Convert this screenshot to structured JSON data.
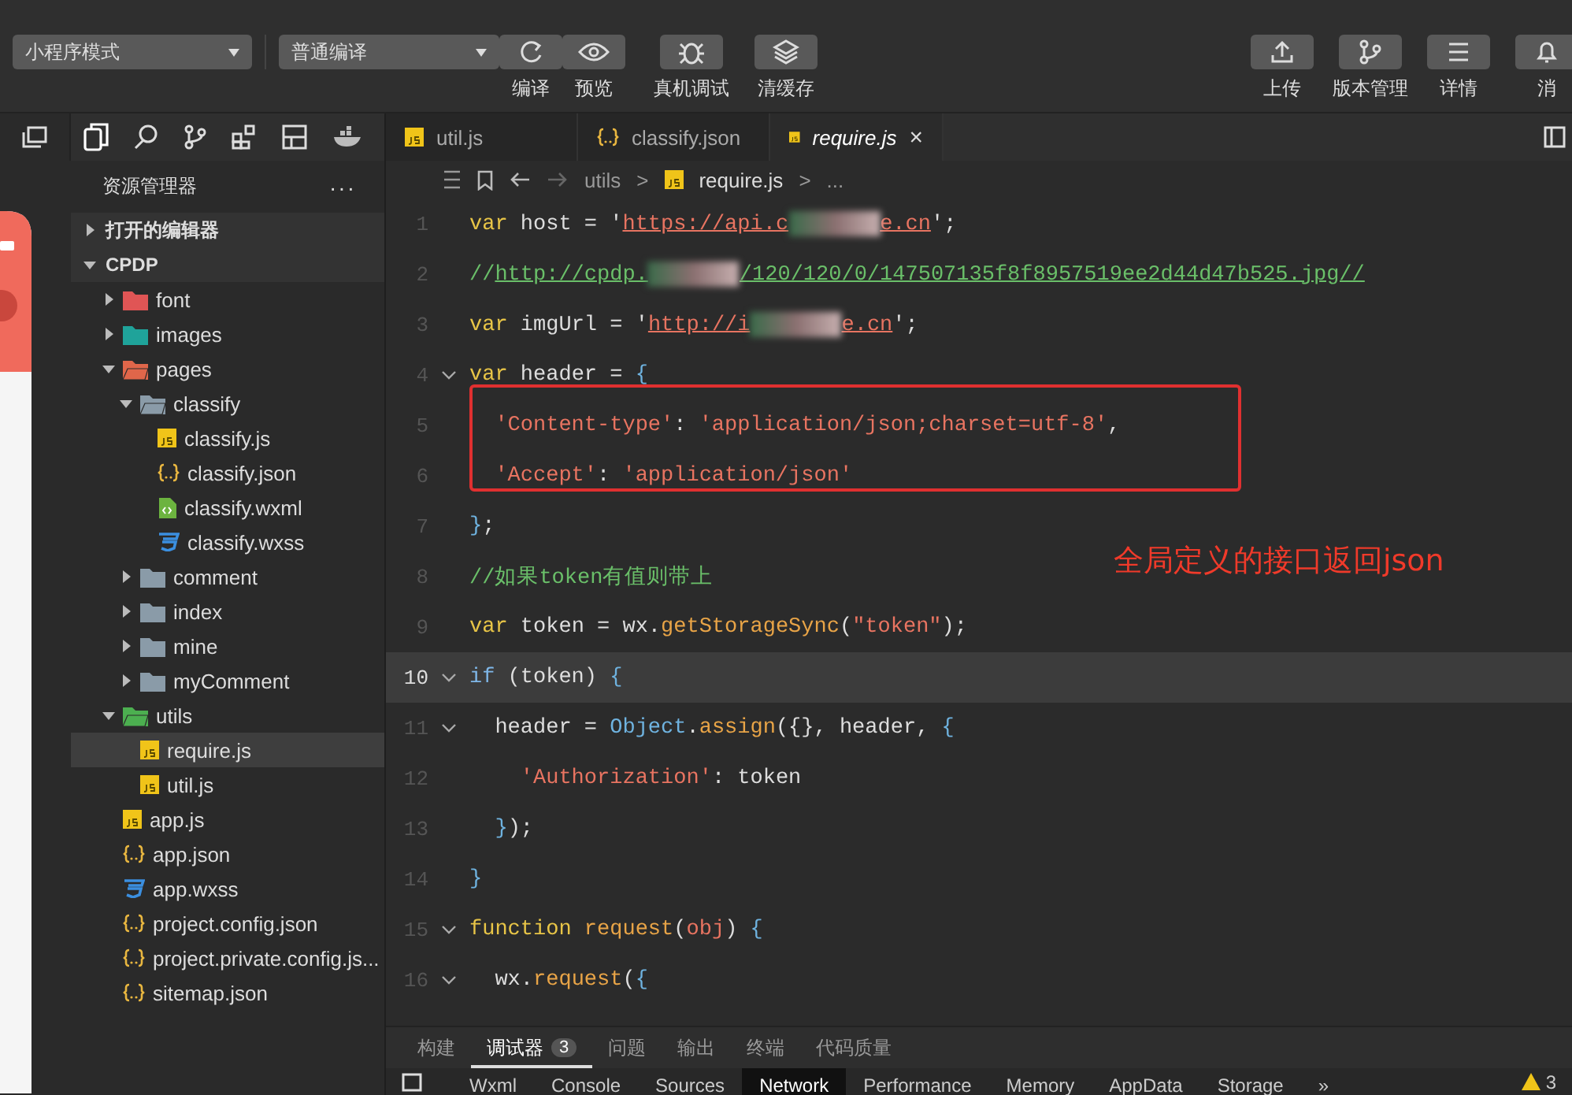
{
  "toolbar": {
    "mode_dropdown": "小程序模式",
    "compile_dropdown": "普通编译",
    "left_buttons": [
      {
        "label": "编译"
      },
      {
        "label": "预览"
      },
      {
        "label": "真机调试"
      },
      {
        "label": "清缓存"
      }
    ],
    "right_buttons": [
      {
        "label": "上传"
      },
      {
        "label": "版本管理"
      },
      {
        "label": "详情"
      },
      {
        "label": "消"
      }
    ]
  },
  "editor_tabs": [
    {
      "label": "util.js",
      "kind": "js",
      "selected": false
    },
    {
      "label": "classify.json",
      "kind": "json",
      "selected": false
    },
    {
      "label": "require.js",
      "kind": "js",
      "selected": true,
      "close": "×"
    }
  ],
  "breadcrumb": [
    "utils",
    ">",
    "require.js",
    ">",
    "..."
  ],
  "sidebar": {
    "title": "资源管理器",
    "more": "···",
    "sections": [
      {
        "label": "打开的编辑器",
        "expanded": false
      },
      {
        "label": "CPDP",
        "expanded": true
      }
    ],
    "tree": [
      {
        "label": "font",
        "kind": "folder",
        "color": "#e05555",
        "expanded": false
      },
      {
        "label": "images",
        "kind": "folder",
        "color": "#1fa39a",
        "expanded": false
      },
      {
        "label": "pages",
        "kind": "folder",
        "color": "#e0664a",
        "expanded": true,
        "children": [
          {
            "label": "classify",
            "kind": "folder",
            "color": "#8a9ba8",
            "expanded": true,
            "children": [
              {
                "label": "classify.js",
                "kind": "js",
                "selected": false
              },
              {
                "label": "classify.json",
                "kind": "json",
                "selected": false
              },
              {
                "label": "classify.wxml",
                "kind": "wxml",
                "selected": false
              },
              {
                "label": "classify.wxss",
                "kind": "wxss",
                "selected": false
              }
            ]
          },
          {
            "label": "comment",
            "kind": "folder",
            "color": "#8a9ba8",
            "expanded": false
          },
          {
            "label": "index",
            "kind": "folder",
            "color": "#8a9ba8",
            "expanded": false
          },
          {
            "label": "mine",
            "kind": "folder",
            "color": "#8a9ba8",
            "expanded": false
          },
          {
            "label": "myComment",
            "kind": "folder",
            "color": "#8a9ba8",
            "expanded": false
          }
        ]
      },
      {
        "label": "utils",
        "kind": "folder",
        "color": "#4caf50",
        "expanded": true,
        "children": [
          {
            "label": "require.js",
            "kind": "js",
            "selected": true
          },
          {
            "label": "util.js",
            "kind": "js",
            "selected": false
          }
        ]
      },
      {
        "label": "app.js",
        "kind": "js",
        "selected": false
      },
      {
        "label": "app.json",
        "kind": "json",
        "selected": false
      },
      {
        "label": "app.wxss",
        "kind": "wxss",
        "selected": false
      },
      {
        "label": "project.config.json",
        "kind": "json",
        "selected": false
      },
      {
        "label": "project.private.config.js...",
        "kind": "json",
        "selected": false
      },
      {
        "label": "sitemap.json",
        "kind": "json",
        "selected": false
      }
    ]
  },
  "code": [
    {
      "number": "1",
      "fold": false,
      "current": false,
      "boxed": false,
      "tokens": [
        {
          "kind": "keyword",
          "text": "var"
        },
        {
          "kind": "plain",
          "text": " host = '"
        },
        {
          "kind": "url",
          "text": "https://api.c"
        },
        {
          "kind": "blur"
        },
        {
          "kind": "url",
          "text": "e.cn"
        },
        {
          "kind": "plain",
          "text": "';"
        }
      ]
    },
    {
      "number": "2",
      "fold": false,
      "current": false,
      "boxed": false,
      "tokens": [
        {
          "kind": "comment",
          "text": "//"
        },
        {
          "kind": "comment_url",
          "text": "http://cpdp."
        },
        {
          "kind": "blur"
        },
        {
          "kind": "comment_url",
          "text": "/120/120/0/147507135f8f8957519ee2d44d47b525.jpg//"
        }
      ]
    },
    {
      "number": "3",
      "fold": false,
      "current": false,
      "boxed": false,
      "tokens": [
        {
          "kind": "keyword",
          "text": "var"
        },
        {
          "kind": "plain",
          "text": " imgUrl = '"
        },
        {
          "kind": "url",
          "text": "http://i"
        },
        {
          "kind": "blur"
        },
        {
          "kind": "url",
          "text": "e.cn"
        },
        {
          "kind": "plain",
          "text": "';"
        }
      ]
    },
    {
      "number": "4",
      "fold": true,
      "current": false,
      "boxed": false,
      "tokens": [
        {
          "kind": "keyword",
          "text": "var"
        },
        {
          "kind": "plain",
          "text": " header = "
        },
        {
          "kind": "brace",
          "text": "{"
        }
      ]
    },
    {
      "number": "5",
      "fold": false,
      "current": false,
      "boxed": true,
      "tokens": [
        {
          "kind": "string",
          "text": "  'Content-type'"
        },
        {
          "kind": "plain",
          "text": ": "
        },
        {
          "kind": "string",
          "text": "'application/json;charset=utf-8'"
        },
        {
          "kind": "plain",
          "text": ","
        }
      ]
    },
    {
      "number": "6",
      "fold": false,
      "current": false,
      "boxed": true,
      "tokens": [
        {
          "kind": "string",
          "text": "  'Accept'"
        },
        {
          "kind": "plain",
          "text": ": "
        },
        {
          "kind": "string",
          "text": "'application/json'"
        }
      ]
    },
    {
      "number": "7",
      "fold": false,
      "current": false,
      "boxed": false,
      "tokens": [
        {
          "kind": "brace",
          "text": "}"
        },
        {
          "kind": "plain",
          "text": ";"
        }
      ]
    },
    {
      "number": "8",
      "fold": false,
      "current": false,
      "boxed": false,
      "tokens": [
        {
          "kind": "comment",
          "text": "//如果token有值则带上"
        }
      ]
    },
    {
      "number": "9",
      "fold": false,
      "current": false,
      "boxed": false,
      "tokens": [
        {
          "kind": "keyword",
          "text": "var"
        },
        {
          "kind": "plain",
          "text": " token = wx."
        },
        {
          "kind": "function",
          "text": "getStorageSync"
        },
        {
          "kind": "plain",
          "text": "("
        },
        {
          "kind": "string",
          "text": "\"token\""
        },
        {
          "kind": "plain",
          "text": ");"
        }
      ]
    },
    {
      "number": "10",
      "fold": true,
      "current": true,
      "boxed": false,
      "tokens": [
        {
          "kind": "control",
          "text": "if"
        },
        {
          "kind": "plain",
          "text": " (token) "
        },
        {
          "kind": "brace",
          "text": "{"
        }
      ]
    },
    {
      "number": "11",
      "fold": true,
      "current": false,
      "boxed": false,
      "tokens": [
        {
          "kind": "plain",
          "text": "  header = "
        },
        {
          "kind": "object",
          "text": "Object"
        },
        {
          "kind": "plain",
          "text": "."
        },
        {
          "kind": "function",
          "text": "assign"
        },
        {
          "kind": "plain",
          "text": "({}, header, "
        },
        {
          "kind": "brace",
          "text": "{"
        }
      ]
    },
    {
      "number": "12",
      "fold": false,
      "current": false,
      "boxed": false,
      "tokens": [
        {
          "kind": "string",
          "text": "    'Authorization'"
        },
        {
          "kind": "plain",
          "text": ": token"
        }
      ]
    },
    {
      "number": "13",
      "fold": false,
      "current": false,
      "boxed": false,
      "tokens": [
        {
          "kind": "brace",
          "text": "  }"
        },
        {
          "kind": "plain",
          "text": ");"
        }
      ]
    },
    {
      "number": "14",
      "fold": false,
      "current": false,
      "boxed": false,
      "tokens": [
        {
          "kind": "brace",
          "text": "}"
        }
      ]
    },
    {
      "number": "15",
      "fold": true,
      "current": false,
      "boxed": false,
      "tokens": [
        {
          "kind": "keyword",
          "text": "function "
        },
        {
          "kind": "function",
          "text": "request"
        },
        {
          "kind": "plain",
          "text": "("
        },
        {
          "kind": "param",
          "text": "obj"
        },
        {
          "kind": "plain",
          "text": ") "
        },
        {
          "kind": "brace",
          "text": "{"
        }
      ]
    },
    {
      "number": "16",
      "fold": true,
      "current": false,
      "boxed": false,
      "tokens": [
        {
          "kind": "plain",
          "text": "  wx."
        },
        {
          "kind": "function",
          "text": "request"
        },
        {
          "kind": "plain",
          "text": "("
        },
        {
          "kind": "brace",
          "text": "{"
        }
      ]
    }
  ],
  "annotation": "全局定义的接口返回json",
  "panel_tabs": [
    {
      "label": "构建",
      "selected": false
    },
    {
      "label": "调试器",
      "selected": true,
      "badge": "3"
    },
    {
      "label": "问题",
      "selected": false
    },
    {
      "label": "输出",
      "selected": false
    },
    {
      "label": "终端",
      "selected": false
    },
    {
      "label": "代码质量",
      "selected": false
    }
  ],
  "devtools_tabs": [
    {
      "label": "Wxml",
      "selected": false
    },
    {
      "label": "Console",
      "selected": false
    },
    {
      "label": "Sources",
      "selected": false
    },
    {
      "label": "Network",
      "selected": true
    },
    {
      "label": "Performance",
      "selected": false
    },
    {
      "label": "Memory",
      "selected": false
    },
    {
      "label": "AppData",
      "selected": false
    },
    {
      "label": "Storage",
      "selected": false
    }
  ],
  "devtools_more": "»",
  "warning_count": "3"
}
